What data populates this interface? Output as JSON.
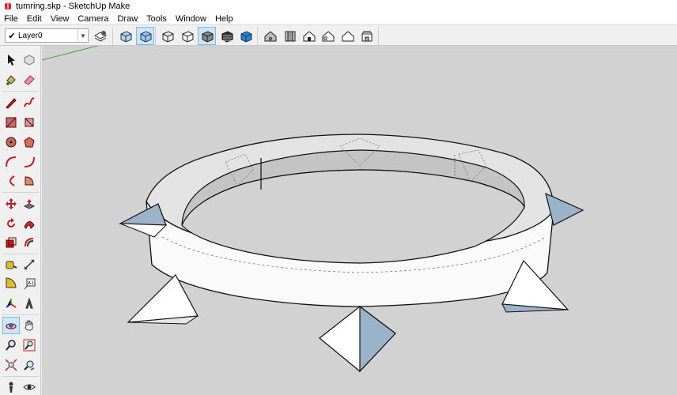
{
  "window": {
    "title": "tumring.skp - SketchUp Make"
  },
  "menu": [
    "File",
    "Edit",
    "View",
    "Camera",
    "Draw",
    "Tools",
    "Window",
    "Help"
  ],
  "layers": {
    "current": "Layer0"
  },
  "toolbar_icons": [
    "layer-manager-icon",
    "xray-style-icon",
    "back-edges-style-icon",
    "wireframe-style-icon",
    "hidden-line-style-icon",
    "shaded-style-icon",
    "shaded-textures-style-icon",
    "monochrome-style-icon",
    "iso-view-icon",
    "top-view-icon",
    "front-view-icon",
    "right-view-icon",
    "back-view-icon",
    "left-view-icon"
  ],
  "colors": {
    "viewport_bg": "#d2d2d2",
    "toolbar_bg": "#f0f0f0",
    "active_tool": "#cde6f7"
  }
}
